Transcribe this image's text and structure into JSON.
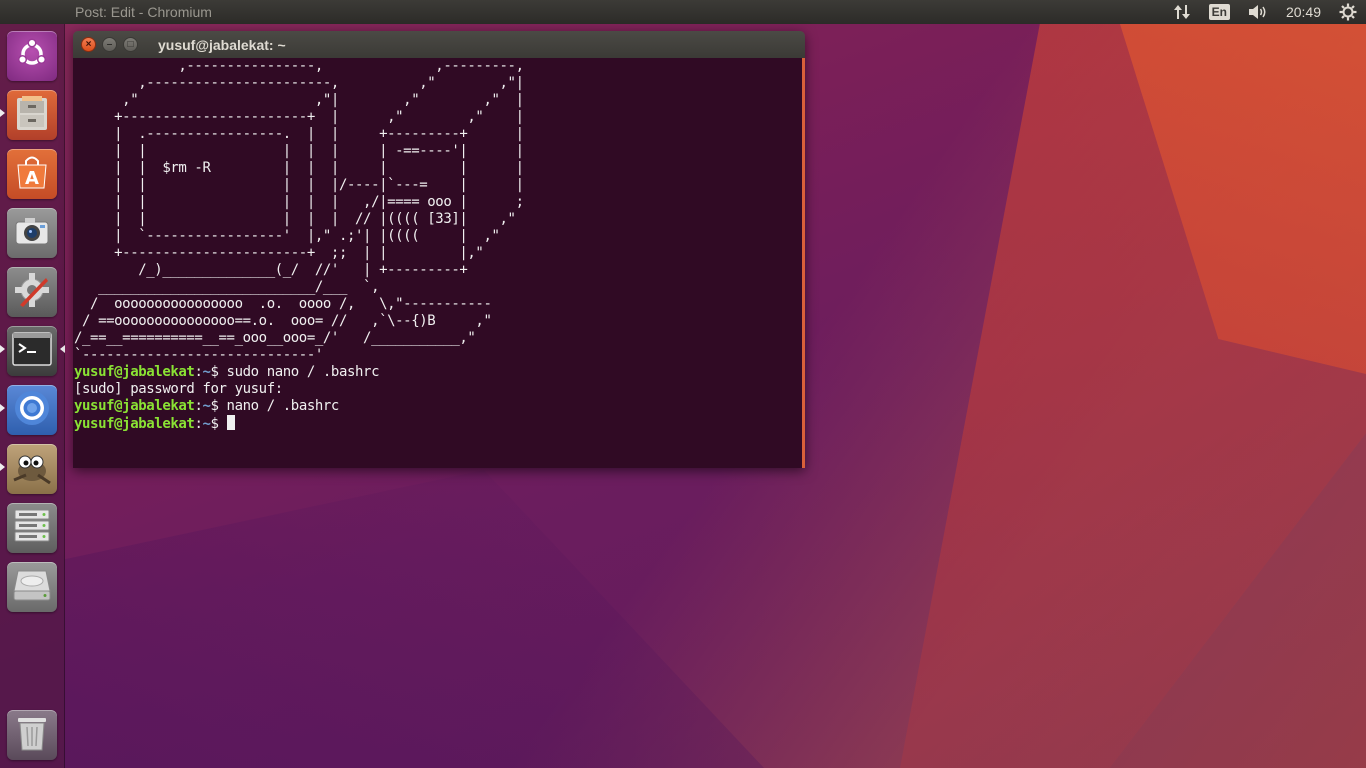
{
  "top_panel": {
    "app_title": "Post: Edit - Chromium",
    "keyboard_layout": "En",
    "clock": "20:49",
    "indicators": [
      "network-updown-icon",
      "keyboard-layout-indicator",
      "volume-icon",
      "clock",
      "session-gear-icon"
    ]
  },
  "launcher": {
    "items": [
      {
        "name": "ubuntu-dash",
        "icon": "ubuntu-logo-icon"
      },
      {
        "name": "files",
        "icon": "file-cabinet-icon"
      },
      {
        "name": "ubuntu-software",
        "icon": "shopping-bag-icon"
      },
      {
        "name": "shotwell",
        "icon": "camera-icon"
      },
      {
        "name": "system-settings",
        "icon": "gear-wrench-icon"
      },
      {
        "name": "terminal",
        "icon": "terminal-icon"
      },
      {
        "name": "chromium",
        "icon": "chromium-icon"
      },
      {
        "name": "gimp",
        "icon": "gimp-icon"
      },
      {
        "name": "server-drives",
        "icon": "server-rack-icon"
      },
      {
        "name": "hard-disk",
        "icon": "hard-disk-icon"
      },
      {
        "name": "trash",
        "icon": "trash-icon"
      }
    ]
  },
  "terminal": {
    "window_title": "yusuf@jabalekat: ~",
    "ascii_art": [
      "             ,----------------,              ,---------,",
      "        ,-----------------------,          ,\"        ,\"|",
      "      ,\"                      ,\"|        ,\"        ,\"  |",
      "     +-----------------------+  |      ,\"        ,\"    |",
      "     |  .-----------------.  |  |     +---------+      |",
      "     |  |                 |  |  |     | -==----'|      |",
      "     |  |  $rm -R         |  |  |     |         |      |",
      "     |  |                 |  |  |/----|`---=    |      |",
      "     |  |                 |  |  |   ,/|==== ooo |      ;",
      "     |  |                 |  |  |  // |(((( [33]|    ,\"",
      "     |  `-----------------'  |,\" .;'| |((((     |  ,\"",
      "     +-----------------------+  ;;  | |         |,\"",
      "        /_)______________(_/  //'   | +---------+",
      "   ___________________________/___  `,",
      "  /  oooooooooooooooo  .o.  oooo /,   \\,\"-----------",
      " / ==ooooooooooooooo==.o.  ooo= //   ,`\\--{)B     ,\"",
      "/_==__==========__==_ooo__ooo=_/'   /___________,\"",
      "`-----------------------------'"
    ],
    "session": [
      {
        "user_host": "yusuf@jabalekat",
        "path": "~",
        "symbol": "$",
        "command": " sudo nano / .bashrc"
      },
      {
        "output": "[sudo] password for yusuf:"
      },
      {
        "user_host": "yusuf@jabalekat",
        "path": "~",
        "symbol": "$",
        "command": " nano / .bashrc"
      },
      {
        "user_host": "yusuf@jabalekat",
        "path": "~",
        "symbol": "$",
        "command": " "
      }
    ]
  },
  "colors": {
    "terminal_bg": "#300a24",
    "prompt_user": "#8ae234",
    "prompt_path": "#729fcf",
    "accent_orange": "#d9603a",
    "panel_bg": "#3c3b37"
  }
}
